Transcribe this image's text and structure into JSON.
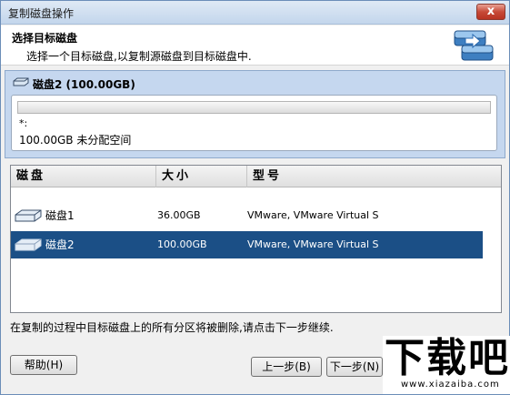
{
  "window": {
    "title": "复制磁盘操作",
    "close_label": "x"
  },
  "header": {
    "title": "选择目标磁盘",
    "subtitle": "选择一个目标磁盘,以复制源磁盘到目标磁盘中."
  },
  "target": {
    "disk_title": "磁盘2 (100.00GB)",
    "partition_label": "*:",
    "partition_desc": "100.00GB 未分配空间"
  },
  "table": {
    "columns": [
      "磁盘",
      "大小",
      "型号"
    ],
    "rows": [
      {
        "name": "磁盘1",
        "size": "36.00GB",
        "model": "VMware, VMware Virtual S",
        "selected": false
      },
      {
        "name": "磁盘2",
        "size": "100.00GB",
        "model": "VMware, VMware Virtual S",
        "selected": true
      }
    ]
  },
  "notice": "在复制的过程中目标磁盘上的所有分区将被删除,请点击下一步继续.",
  "buttons": {
    "help": "帮助(H)",
    "prev": "上一步(B)",
    "next": "下一步(N)"
  },
  "watermark": {
    "text": "下载吧",
    "url": "www.xiazaiba.com"
  },
  "colors": {
    "selection": "#1b4f86",
    "panel": "#c5d7ef"
  }
}
